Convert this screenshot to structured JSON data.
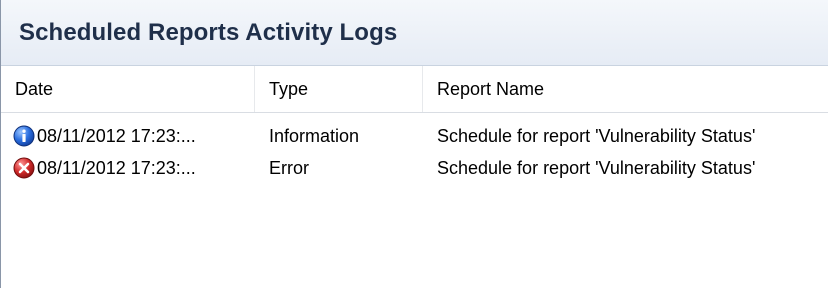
{
  "panel": {
    "title": "Scheduled Reports Activity Logs"
  },
  "columns": {
    "date": "Date",
    "type": "Type",
    "report_name": "Report Name"
  },
  "rows": [
    {
      "icon": "info-icon",
      "date": "08/11/2012 17:23:...",
      "type": "Information",
      "report_name": "Schedule for report 'Vulnerability Status'"
    },
    {
      "icon": "error-icon",
      "date": "08/11/2012 17:23:...",
      "type": "Error",
      "report_name": "Schedule for report 'Vulnerability Status'"
    }
  ],
  "colors": {
    "info_blue": "#1f5fcf",
    "error_red": "#d22b2b",
    "header_text": "#1f2f4a"
  }
}
